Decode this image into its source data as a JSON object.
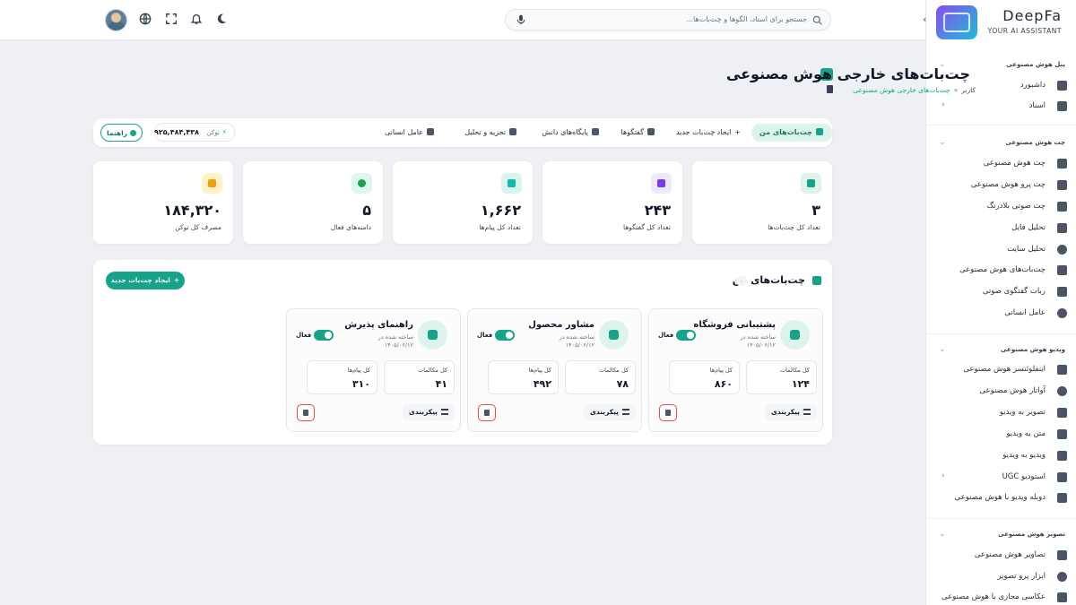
{
  "header": {
    "search_placeholder": "جستجو برای اسناد، الگوها و چت‌بات‌ها...",
    "icons": [
      "avatar",
      "globe-icon",
      "fullscreen-icon",
      "bell-icon",
      "moon-icon",
      "search-icon",
      "mic-icon"
    ]
  },
  "brand": {
    "name": "DeepFa",
    "tagline": "YOUR AI ASSISTANT"
  },
  "sidebar": {
    "sections": [
      {
        "title": "پنل هوش مصنوعی",
        "items": [
          {
            "label": "داشبورد",
            "icon": "dashboard-icon"
          },
          {
            "label": "اسناد",
            "icon": "folder-icon",
            "has_submenu": true
          }
        ]
      },
      {
        "title": "چت هوش مصنوعی",
        "items": [
          {
            "label": "چت هوش مصنوعی",
            "icon": "chat-icon"
          },
          {
            "label": "چت پرو هوش مصنوعی",
            "icon": "chat-pro-icon"
          },
          {
            "label": "چت صوتی بلادرنگ",
            "icon": "waveform-icon"
          },
          {
            "label": "تحلیل فایل",
            "icon": "file-icon"
          },
          {
            "label": "تحلیل سایت",
            "icon": "globe-icon"
          },
          {
            "label": "چت‌بات‌های هوش مصنوعی",
            "icon": "robot-icon"
          },
          {
            "label": "ربات گفتگوی صوتی",
            "icon": "voice-bot-icon"
          },
          {
            "label": "عامل انسانی",
            "icon": "headset-icon"
          }
        ]
      },
      {
        "title": "ویدیو هوش مصنوعی",
        "items": [
          {
            "label": "اینفلوئنسر هوش مصنوعی",
            "icon": "video-icon"
          },
          {
            "label": "آواتار هوش مصنوعی",
            "icon": "avatar-icon"
          },
          {
            "label": "تصویر به ویدیو",
            "icon": "image-video-icon"
          },
          {
            "label": "متن به ویدیو",
            "icon": "text-video-icon"
          },
          {
            "label": "ویدیو به ویدیو",
            "icon": "video-video-icon"
          },
          {
            "label": "استودیو UGC",
            "icon": "studio-icon",
            "has_submenu": true
          },
          {
            "label": "دوبله ویدیو با هوش مصنوعی",
            "icon": "dubbing-icon"
          }
        ]
      },
      {
        "title": "تصویر هوش مصنوعی",
        "items": [
          {
            "label": "تصاویر هوش مصنوعی",
            "icon": "image-icon"
          },
          {
            "label": "ابزار پرو تصویر",
            "icon": "pro-image-icon"
          },
          {
            "label": "عکاسی مجازی با هوش مصنوعی",
            "icon": "camera-icon"
          }
        ]
      }
    ]
  },
  "page": {
    "title": "چت‌بات‌های خارجی هوش مصنوعی",
    "breadcrumb": [
      "کاربر",
      "»",
      "چت‌بات‌های خارجی هوش مصنوعی"
    ]
  },
  "tabs": [
    {
      "label": "چت‌بات‌های من",
      "active": true
    },
    {
      "label": "ایجاد چت‌بات جدید"
    },
    {
      "label": "گفتگوها"
    },
    {
      "label": "پایگاه‌های دانش"
    },
    {
      "label": "تجزیه و تحلیل"
    },
    {
      "label": "عامل انسانی"
    }
  ],
  "token": {
    "label": "توکن",
    "value": "۹۲۵,۴۸۴,۴۳۸"
  },
  "guide_label": "راهنما",
  "stats": [
    {
      "value": "۳",
      "label": "تعداد کل چت‌بات‌ها",
      "color": "#ddf3ec",
      "accent": "#16a38a"
    },
    {
      "value": "۲۴۳",
      "label": "تعداد کل گفتگوها",
      "color": "#ede9fe",
      "accent": "#7c3aed"
    },
    {
      "value": "۱,۶۶۲",
      "label": "تعداد کل پیام‌ها",
      "color": "#d9f3ef",
      "accent": "#14b8a6"
    },
    {
      "value": "۵",
      "label": "دامنه‌های فعال",
      "color": "#def7ec",
      "accent": "#16a34a"
    },
    {
      "value": "۱۸۴,۳۲۰",
      "label": "مصرف کل توکن",
      "color": "#fef3c7",
      "accent": "#f59e0b"
    }
  ],
  "bots_panel": {
    "title": "چت‌بات‌های من",
    "count": "۰",
    "new_button": "ایجاد چت‌بات جدید",
    "bots": [
      {
        "name": "پشتیبانی فروشگاه",
        "created_label": "ساخته شده در",
        "date": "۱۴۰۵/۰۶/۱۲",
        "status": "فعال",
        "conv_label": "کل مکالمات",
        "conv": "۱۲۴",
        "msg_label": "کل پیام‌ها",
        "msg": "۸۶۰",
        "config": "پیکربندی"
      },
      {
        "name": "مشاور محصول",
        "created_label": "ساخته شده در",
        "date": "۱۴۰۵/۰۶/۱۲",
        "status": "فعال",
        "conv_label": "کل مکالمات",
        "conv": "۷۸",
        "msg_label": "کل پیام‌ها",
        "msg": "۴۹۲",
        "config": "پیکربندی"
      },
      {
        "name": "راهنمای پذیرش",
        "created_label": "ساخته شده در",
        "date": "۱۴۰۵/۰۶/۱۲",
        "status": "فعال",
        "conv_label": "کل مکالمات",
        "conv": "۴۱",
        "msg_label": "کل پیام‌ها",
        "msg": "۳۱۰",
        "config": "پیکربندی"
      }
    ]
  },
  "colors": {
    "accent": "#16a38a",
    "accent_light": "#ddf3ec",
    "danger": "#ef4444",
    "background": "#eef0f3"
  }
}
